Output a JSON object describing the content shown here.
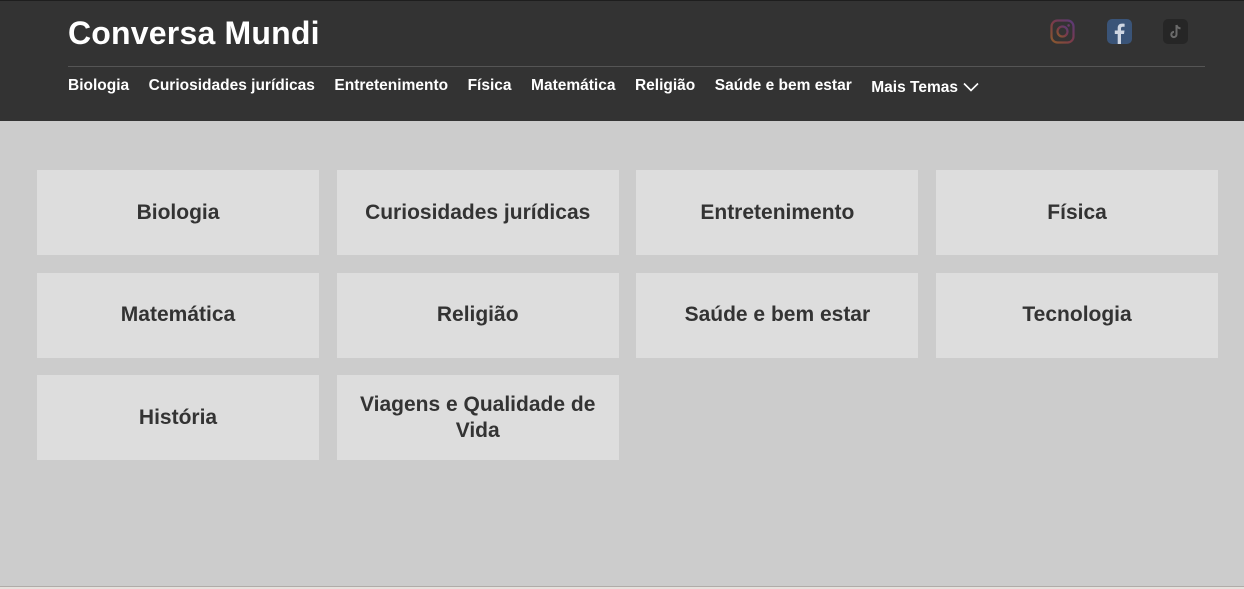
{
  "header": {
    "title": "Conversa Mundi",
    "social": [
      "instagram-icon",
      "facebook-icon",
      "tiktok-icon"
    ]
  },
  "nav": {
    "items": [
      "Biologia",
      "Curiosidades jurídicas",
      "Entretenimento",
      "Física",
      "Matemática",
      "Religião",
      "Saúde e bem estar"
    ],
    "more_label": "Mais Temas"
  },
  "topics": [
    "Biologia",
    "Curiosidades jurídicas",
    "Entretenimento",
    "Física",
    "Matemática",
    "Religião",
    "Saúde e bem estar",
    "Tecnologia",
    "História",
    "Viagens e Qualidade de Vida"
  ],
  "colors": {
    "header_bg": "#333333",
    "page_bg": "#cccccc",
    "card_bg": "#dddddd",
    "card_text": "#333333"
  }
}
